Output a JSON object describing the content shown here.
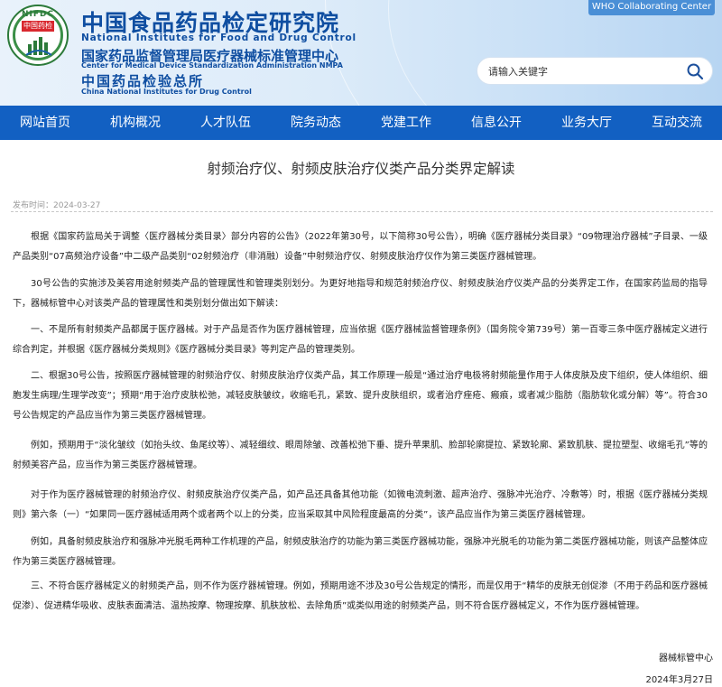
{
  "header": {
    "logo": {
      "abbr": "NIFDC",
      "text_cn": "中国药检"
    },
    "title_cn": "中国食品药品检定研究院",
    "title_en": "National Institutes for Food and Drug Control",
    "sub1_cn": "国家药品监督管理局医疗器械标准管理中心",
    "sub1_en": "Center for Medical Device Standardization Administration NMPA",
    "sub2_cn": "中国药品检验总所",
    "sub2_en": "China National Institutes for Drug Control",
    "who_label": "WHO Collaborating Center",
    "search_placeholder": "请输入关键字",
    "colors": {
      "brand": "#0f4ea1",
      "nav": "#1260c2",
      "who": "#4a8fd6"
    }
  },
  "nav": {
    "items": [
      {
        "label": "网站首页"
      },
      {
        "label": "机构概况"
      },
      {
        "label": "人才队伍"
      },
      {
        "label": "院务动态"
      },
      {
        "label": "党建工作"
      },
      {
        "label": "信息公开"
      },
      {
        "label": "业务大厅"
      },
      {
        "label": "互动交流"
      }
    ]
  },
  "article": {
    "title": "射频治疗仪、射频皮肤治疗仪类产品分类界定解读",
    "meta": "发布时间：2024-03-27",
    "paragraphs": [
      "根据《国家药监局关于调整〈医疗器械分类目录〉部分内容的公告》（2022年第30号，以下简称30号公告），明确《医疗器械分类目录》“09物理治疗器械”子目录、一级产品类别“07高频治疗设备”中二级产品类别“02射频治疗（非消融）设备”中射频治疗仪、射频皮肤治疗仪作为第三类医疗器械管理。",
      "30号公告的实施涉及美容用途射频类产品的管理属性和管理类别划分。为更好地指导和规范射频治疗仪、射频皮肤治疗仪类产品的分类界定工作，在国家药监局的指导下，器械标管中心对该类产品的管理属性和类别划分做出如下解读：",
      "一、不是所有射频类产品都属于医疗器械。对于产品是否作为医疗器械管理，应当依据《医疗器械监督管理条例》（国务院令第739号）第一百零三条中医疗器械定义进行综合判定，并根据《医疗器械分类规则》《医疗器械分类目录》等判定产品的管理类别。",
      "二、根据30号公告，按照医疗器械管理的射频治疗仪、射频皮肤治疗仪类产品，其工作原理一般是“通过治疗电极将射频能量作用于人体皮肤及皮下组织，使人体组织、细胞发生病理/生理学改变”；预期“用于治疗皮肤松弛，减轻皮肤皱纹，收缩毛孔，紧致、提升皮肤组织，或者治疗痤疮、瘢痕，或者减少脂肪（脂肪软化或分解）等”。符合30号公告规定的产品应当作为第三类医疗器械管理。",
      "例如，预期用于“淡化皱纹（如抬头纹、鱼尾纹等）、减轻细纹、眼周除皱、改善松弛下垂、提升苹果肌、脸部轮廓提拉、紧致轮廓、紧致肌肤、提拉塑型、收缩毛孔”等的射频美容产品，应当作为第三类医疗器械管理。",
      "对于作为医疗器械管理的射频治疗仪、射频皮肤治疗仪类产品，如产品还具备其他功能（如微电流刺激、超声治疗、强脉冲光治疗、冷敷等）时，根据《医疗器械分类规则》第六条（一）“如果同一医疗器械适用两个或者两个以上的分类，应当采取其中风险程度最高的分类”，该产品应当作为第三类医疗器械管理。",
      "例如，具备射频皮肤治疗和强脉冲光脱毛两种工作机理的产品，射频皮肤治疗的功能为第三类医疗器械功能，强脉冲光脱毛的功能为第二类医疗器械功能，则该产品整体应作为第三类医疗器械管理。",
      "三、不符合医疗器械定义的射频类产品，则不作为医疗器械管理。例如，预期用途不涉及30号公告规定的情形，而是仅用于“精华的皮肤无创促渗（不用于药品和医疗器械促渗）、促进精华吸收、皮肤表面清洁、温热按摩、物理按摩、肌肤放松、去除角质”或类似用途的射频类产品，则不符合医疗器械定义，不作为医疗器械管理。"
    ],
    "signature": "器械标管中心",
    "date": "2024年3月27日"
  }
}
